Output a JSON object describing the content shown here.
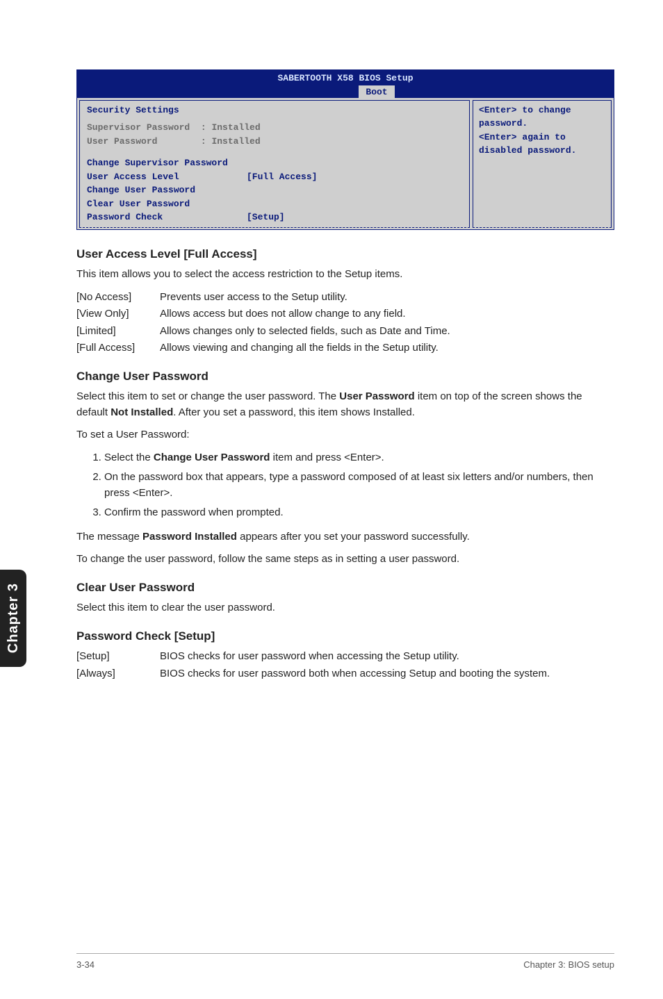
{
  "bios": {
    "title": "SABERTOOTH X58 BIOS Setup",
    "tab": "Boot",
    "heading": "Security Settings",
    "rows_gray": [
      {
        "label": "Supervisor Password",
        "sep": "  : ",
        "value": "Installed"
      },
      {
        "label": "User Password",
        "sep": "        : ",
        "value": "Installed"
      }
    ],
    "rows_blue": [
      {
        "label": "Change Supervisor Password",
        "value": ""
      },
      {
        "label": "User Access Level",
        "value": "[Full Access]"
      },
      {
        "label": "Change User Password",
        "value": ""
      },
      {
        "label": "Clear User Password",
        "value": ""
      },
      {
        "label": "Password Check",
        "value": "[Setup]"
      }
    ],
    "help": {
      "l1": "<Enter> to change",
      "l2": "password.",
      "l3": "<Enter> again to",
      "l4": "disabled password."
    }
  },
  "s1": {
    "title": "User Access Level [Full Access]",
    "desc": "This item allows you to select the access restriction to the Setup items.",
    "opts": [
      {
        "k": "[No Access]",
        "v": "Prevents user access to the Setup utility."
      },
      {
        "k": "[View Only]",
        "v": "Allows access but does not allow change to any field."
      },
      {
        "k": "[Limited]",
        "v": "Allows changes only to selected fields, such as Date and Time."
      },
      {
        "k": "[Full Access]",
        "v": "Allows viewing and changing all the fields in the Setup utility."
      }
    ]
  },
  "s2": {
    "title": "Change User Password",
    "p1a": "Select this item to set or change the user password. The ",
    "p1b": "User Password",
    "p1c": " item on top of the screen shows the default ",
    "p1d": "Not Installed",
    "p1e": ". After you set a password, this item shows Installed.",
    "p2": "To set a User Password:",
    "li1a": "Select the ",
    "li1b": "Change User Password",
    "li1c": " item and press <Enter>.",
    "li2": "On the password box that appears, type a password composed of at least six letters and/or numbers, then press <Enter>.",
    "li3": "Confirm the password when prompted.",
    "p3a": "The message ",
    "p3b": "Password Installed",
    "p3c": " appears after you set your password successfully.",
    "p4": "To change the user password, follow the same steps as in setting a user password."
  },
  "s3": {
    "title": "Clear User Password",
    "p1": "Select this item to clear the user password."
  },
  "s4": {
    "title": "Password Check [Setup]",
    "opts": [
      {
        "k": "[Setup]",
        "v": "BIOS checks for user password when accessing the Setup utility."
      },
      {
        "k": "[Always]",
        "v": "BIOS checks for user password both when accessing Setup and booting the system."
      }
    ]
  },
  "side": "Chapter 3",
  "footer": {
    "left": "3-34",
    "right": "Chapter 3: BIOS setup"
  }
}
